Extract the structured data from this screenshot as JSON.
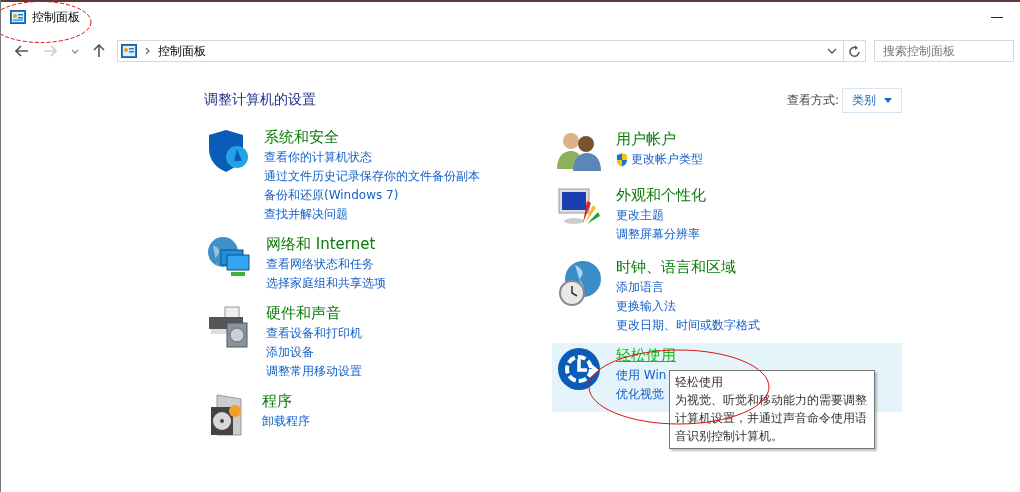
{
  "window": {
    "title": "控制面板",
    "minimize": "—"
  },
  "nav": {
    "path": "控制面板",
    "search_placeholder": "搜索控制面板"
  },
  "content": {
    "heading": "调整计算机的设置",
    "view_by_label": "查看方式:",
    "view_by_value": "类别"
  },
  "columns": [
    {
      "categories": [
        {
          "title": "系统和安全",
          "highlighted": false,
          "links": [
            {
              "text": "查看你的计算机状态",
              "shield": false
            },
            {
              "text": "通过文件历史记录保存你的文件备份副本",
              "shield": false
            },
            {
              "text": "备份和还原(Windows 7)",
              "shield": false
            },
            {
              "text": "查找并解决问题",
              "shield": false
            }
          ]
        },
        {
          "title": "网络和 Internet",
          "highlighted": false,
          "links": [
            {
              "text": "查看网络状态和任务",
              "shield": false
            },
            {
              "text": "选择家庭组和共享选项",
              "shield": false
            }
          ]
        },
        {
          "title": "硬件和声音",
          "highlighted": false,
          "links": [
            {
              "text": "查看设备和打印机",
              "shield": false
            },
            {
              "text": "添加设备",
              "shield": false
            },
            {
              "text": "调整常用移动设置",
              "shield": false
            }
          ]
        },
        {
          "title": "程序",
          "highlighted": false,
          "links": [
            {
              "text": "卸载程序",
              "shield": false
            }
          ]
        }
      ]
    },
    {
      "categories": [
        {
          "title": "用户帐户",
          "highlighted": false,
          "links": [
            {
              "text": "更改帐户类型",
              "shield": true
            }
          ]
        },
        {
          "title": "外观和个性化",
          "highlighted": false,
          "links": [
            {
              "text": "更改主题",
              "shield": false
            },
            {
              "text": "调整屏幕分辨率",
              "shield": false
            }
          ]
        },
        {
          "title": "时钟、语言和区域",
          "highlighted": false,
          "links": [
            {
              "text": "添加语言",
              "shield": false
            },
            {
              "text": "更换输入法",
              "shield": false
            },
            {
              "text": "更改日期、时间或数字格式",
              "shield": false
            }
          ]
        },
        {
          "title": "轻松使用",
          "highlighted": true,
          "links": [
            {
              "text": "使用 Win",
              "shield": false
            },
            {
              "text": "优化视觉",
              "shield": false
            }
          ]
        }
      ]
    }
  ],
  "tooltip": {
    "title": "轻松使用",
    "text": "为视觉、听觉和移动能力的需要调整计算机设置，并通过声音命令使用语音识别控制计算机。"
  }
}
